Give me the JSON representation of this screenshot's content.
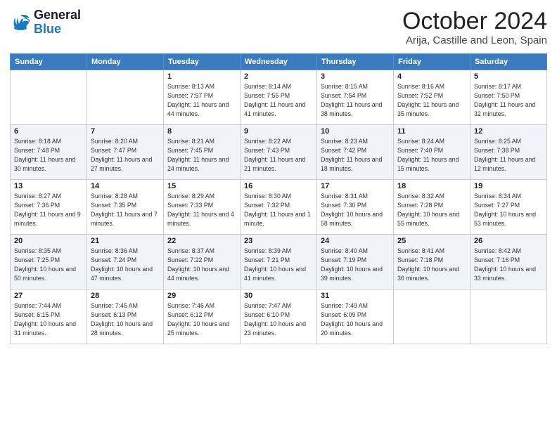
{
  "logo": {
    "line1": "General",
    "line2": "Blue"
  },
  "title": "October 2024",
  "location": "Arija, Castille and Leon, Spain",
  "days_header": [
    "Sunday",
    "Monday",
    "Tuesday",
    "Wednesday",
    "Thursday",
    "Friday",
    "Saturday"
  ],
  "weeks": [
    [
      {
        "day": "",
        "info": ""
      },
      {
        "day": "",
        "info": ""
      },
      {
        "day": "1",
        "info": "Sunrise: 8:13 AM\nSunset: 7:57 PM\nDaylight: 11 hours and 44 minutes."
      },
      {
        "day": "2",
        "info": "Sunrise: 8:14 AM\nSunset: 7:55 PM\nDaylight: 11 hours and 41 minutes."
      },
      {
        "day": "3",
        "info": "Sunrise: 8:15 AM\nSunset: 7:54 PM\nDaylight: 11 hours and 38 minutes."
      },
      {
        "day": "4",
        "info": "Sunrise: 8:16 AM\nSunset: 7:52 PM\nDaylight: 11 hours and 35 minutes."
      },
      {
        "day": "5",
        "info": "Sunrise: 8:17 AM\nSunset: 7:50 PM\nDaylight: 11 hours and 32 minutes."
      }
    ],
    [
      {
        "day": "6",
        "info": "Sunrise: 8:18 AM\nSunset: 7:48 PM\nDaylight: 11 hours and 30 minutes."
      },
      {
        "day": "7",
        "info": "Sunrise: 8:20 AM\nSunset: 7:47 PM\nDaylight: 11 hours and 27 minutes."
      },
      {
        "day": "8",
        "info": "Sunrise: 8:21 AM\nSunset: 7:45 PM\nDaylight: 11 hours and 24 minutes."
      },
      {
        "day": "9",
        "info": "Sunrise: 8:22 AM\nSunset: 7:43 PM\nDaylight: 11 hours and 21 minutes."
      },
      {
        "day": "10",
        "info": "Sunrise: 8:23 AM\nSunset: 7:42 PM\nDaylight: 11 hours and 18 minutes."
      },
      {
        "day": "11",
        "info": "Sunrise: 8:24 AM\nSunset: 7:40 PM\nDaylight: 11 hours and 15 minutes."
      },
      {
        "day": "12",
        "info": "Sunrise: 8:25 AM\nSunset: 7:38 PM\nDaylight: 11 hours and 12 minutes."
      }
    ],
    [
      {
        "day": "13",
        "info": "Sunrise: 8:27 AM\nSunset: 7:36 PM\nDaylight: 11 hours and 9 minutes."
      },
      {
        "day": "14",
        "info": "Sunrise: 8:28 AM\nSunset: 7:35 PM\nDaylight: 11 hours and 7 minutes."
      },
      {
        "day": "15",
        "info": "Sunrise: 8:29 AM\nSunset: 7:33 PM\nDaylight: 11 hours and 4 minutes."
      },
      {
        "day": "16",
        "info": "Sunrise: 8:30 AM\nSunset: 7:32 PM\nDaylight: 11 hours and 1 minute."
      },
      {
        "day": "17",
        "info": "Sunrise: 8:31 AM\nSunset: 7:30 PM\nDaylight: 10 hours and 58 minutes."
      },
      {
        "day": "18",
        "info": "Sunrise: 8:32 AM\nSunset: 7:28 PM\nDaylight: 10 hours and 55 minutes."
      },
      {
        "day": "19",
        "info": "Sunrise: 8:34 AM\nSunset: 7:27 PM\nDaylight: 10 hours and 53 minutes."
      }
    ],
    [
      {
        "day": "20",
        "info": "Sunrise: 8:35 AM\nSunset: 7:25 PM\nDaylight: 10 hours and 50 minutes."
      },
      {
        "day": "21",
        "info": "Sunrise: 8:36 AM\nSunset: 7:24 PM\nDaylight: 10 hours and 47 minutes."
      },
      {
        "day": "22",
        "info": "Sunrise: 8:37 AM\nSunset: 7:22 PM\nDaylight: 10 hours and 44 minutes."
      },
      {
        "day": "23",
        "info": "Sunrise: 8:39 AM\nSunset: 7:21 PM\nDaylight: 10 hours and 41 minutes."
      },
      {
        "day": "24",
        "info": "Sunrise: 8:40 AM\nSunset: 7:19 PM\nDaylight: 10 hours and 39 minutes."
      },
      {
        "day": "25",
        "info": "Sunrise: 8:41 AM\nSunset: 7:18 PM\nDaylight: 10 hours and 36 minutes."
      },
      {
        "day": "26",
        "info": "Sunrise: 8:42 AM\nSunset: 7:16 PM\nDaylight: 10 hours and 33 minutes."
      }
    ],
    [
      {
        "day": "27",
        "info": "Sunrise: 7:44 AM\nSunset: 6:15 PM\nDaylight: 10 hours and 31 minutes."
      },
      {
        "day": "28",
        "info": "Sunrise: 7:45 AM\nSunset: 6:13 PM\nDaylight: 10 hours and 28 minutes."
      },
      {
        "day": "29",
        "info": "Sunrise: 7:46 AM\nSunset: 6:12 PM\nDaylight: 10 hours and 25 minutes."
      },
      {
        "day": "30",
        "info": "Sunrise: 7:47 AM\nSunset: 6:10 PM\nDaylight: 10 hours and 23 minutes."
      },
      {
        "day": "31",
        "info": "Sunrise: 7:49 AM\nSunset: 6:09 PM\nDaylight: 10 hours and 20 minutes."
      },
      {
        "day": "",
        "info": ""
      },
      {
        "day": "",
        "info": ""
      }
    ]
  ]
}
